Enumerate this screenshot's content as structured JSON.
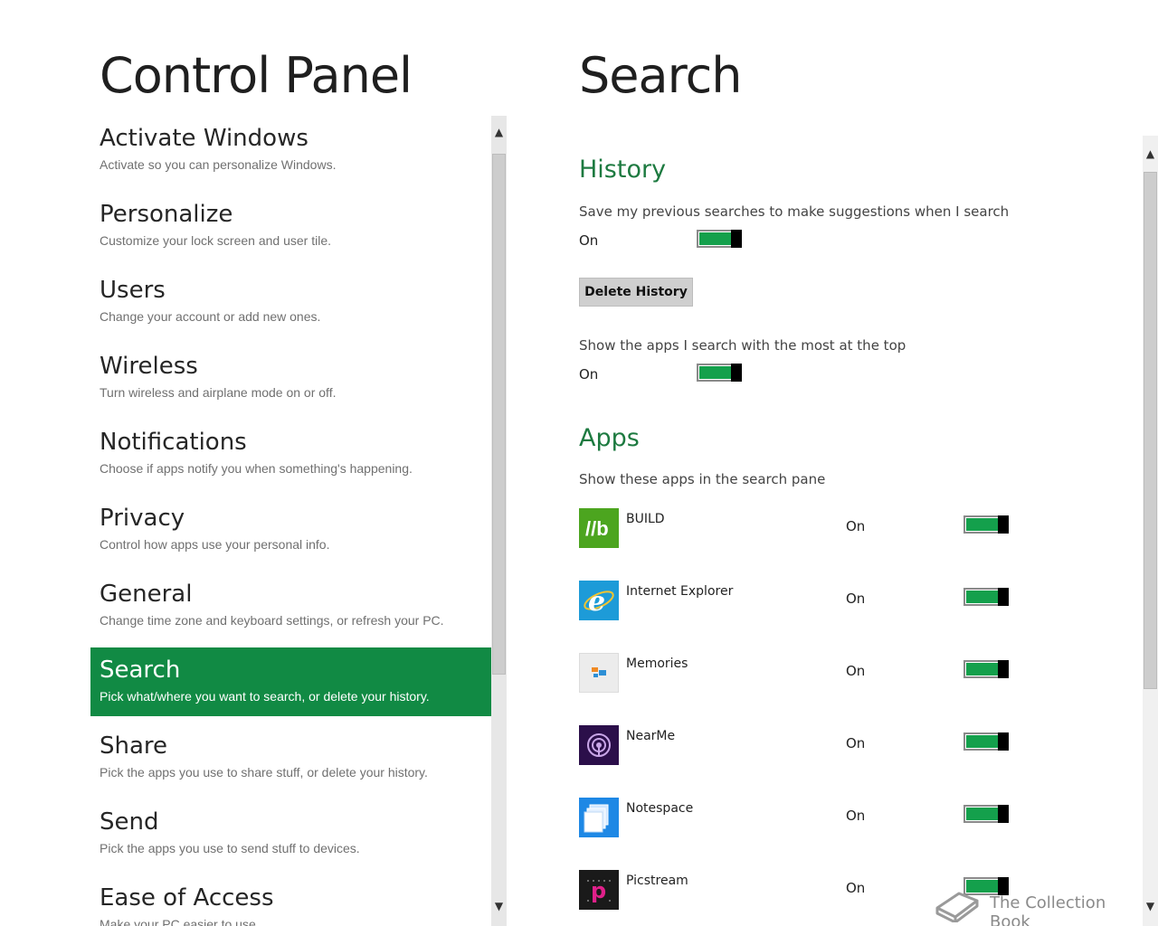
{
  "left_panel": {
    "title": "Control Panel",
    "categories": [
      {
        "title": "Activate Windows",
        "desc": "Activate so you can personalize Windows."
      },
      {
        "title": "Personalize",
        "desc": "Customize your lock screen and user tile."
      },
      {
        "title": "Users",
        "desc": "Change your account or add new ones."
      },
      {
        "title": "Wireless",
        "desc": "Turn wireless and airplane mode on or off."
      },
      {
        "title": "Notifications",
        "desc": "Choose if apps notify you when something's happening."
      },
      {
        "title": "Privacy",
        "desc": "Control how apps use your personal info."
      },
      {
        "title": "General",
        "desc": "Change time zone and keyboard settings, or refresh your PC."
      },
      {
        "title": "Search",
        "desc": "Pick what/where you want to search, or delete your history."
      },
      {
        "title": "Share",
        "desc": "Pick the apps you use to share stuff, or delete your history."
      },
      {
        "title": "Send",
        "desc": "Pick the apps you use to send stuff to devices."
      },
      {
        "title": "Ease of Access",
        "desc": "Make your PC easier to use."
      }
    ],
    "selected_category": "Search"
  },
  "right_panel": {
    "title": "Search",
    "history": {
      "heading": "History",
      "save_searches_label": "Save my previous searches to make suggestions when I search",
      "save_searches_state": "On",
      "delete_button": "Delete History",
      "show_apps_label": "Show the apps I search with the most at the top",
      "show_apps_state": "On"
    },
    "apps": {
      "heading": "Apps",
      "description": "Show these apps in the search pane",
      "list": [
        {
          "name": "BUILD",
          "state": "On",
          "icon": "build-icon"
        },
        {
          "name": "Internet Explorer",
          "state": "On",
          "icon": "internet-explorer-icon"
        },
        {
          "name": "Memories",
          "state": "On",
          "icon": "memories-icon"
        },
        {
          "name": "NearMe",
          "state": "On",
          "icon": "nearme-icon"
        },
        {
          "name": "Notespace",
          "state": "On",
          "icon": "notespace-icon"
        },
        {
          "name": "Picstream",
          "state": "On",
          "icon": "picstream-icon"
        }
      ]
    }
  },
  "watermark": {
    "text": "The Collection Book",
    "icon": "book-icon"
  },
  "colors": {
    "accent": "#118a44",
    "heading_green": "#1d7a40",
    "toggle_fill": "#14a04c"
  },
  "icons": {
    "scroll_up": "▲",
    "scroll_down": "▼"
  }
}
